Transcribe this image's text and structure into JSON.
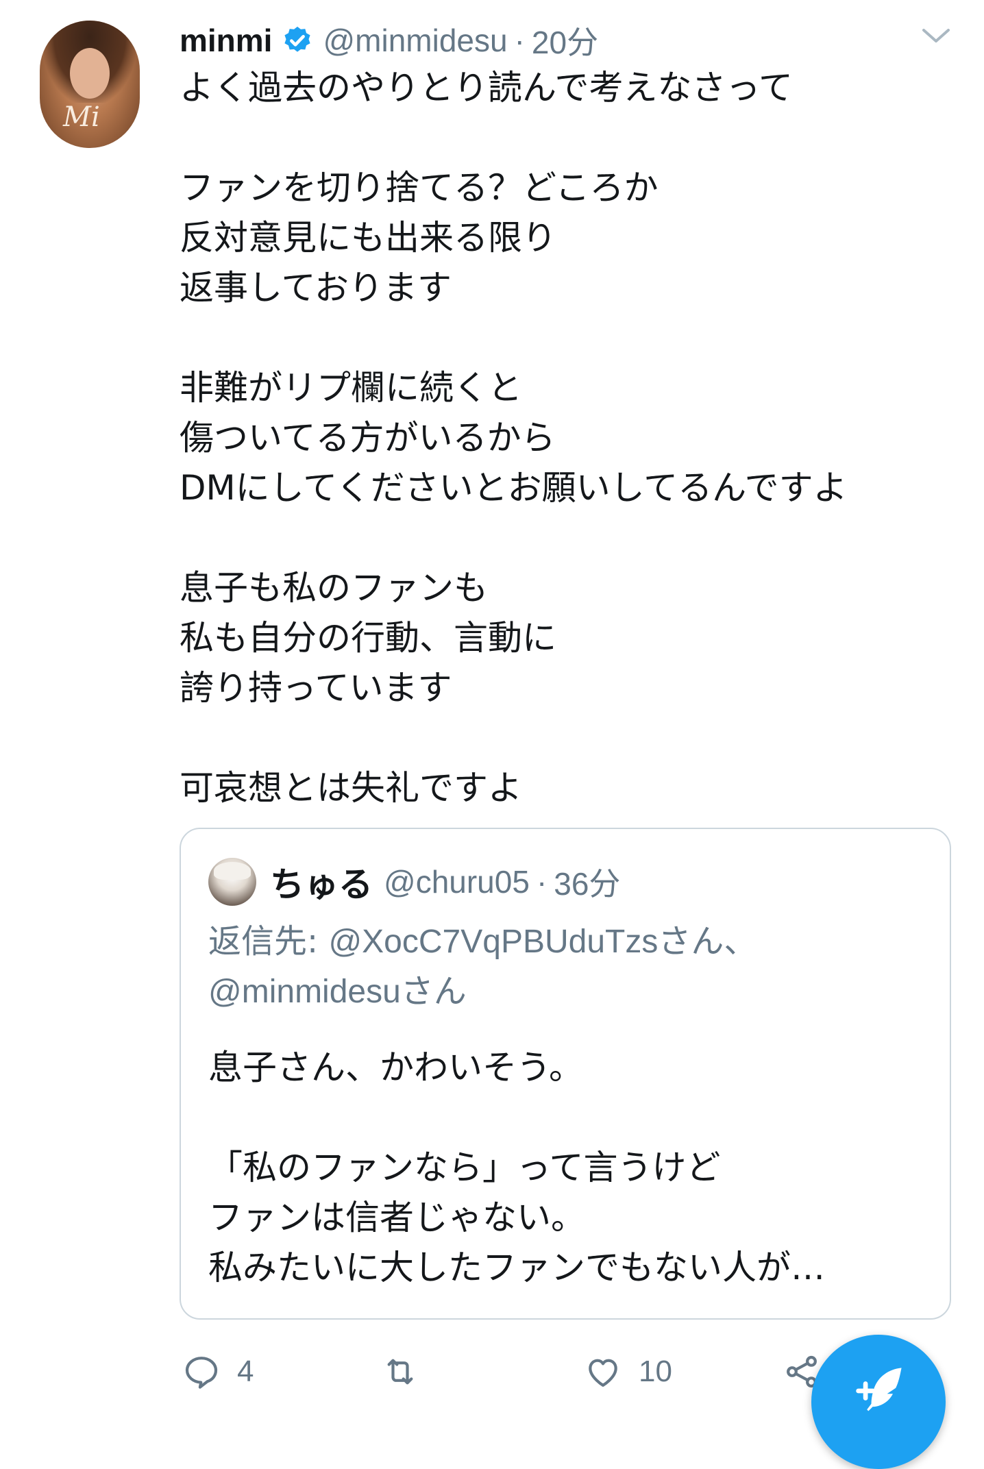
{
  "tweet": {
    "author": {
      "name": "minmi",
      "handle": "@minmidesu",
      "verified": true,
      "avatar_signature": "Mi"
    },
    "separator": "·",
    "time": "20分",
    "text": "よく過去のやりとり読んで考えなさって\n\nファンを切り捨てる？どころか\n反対意見にも出来る限り\n返事しております\n\n非難がリプ欄に続くと\n傷ついてる方がいるから\nDMにしてくださいとお願いしてるんですよ\n\n息子も私のファンも\n私も自分の行動、言動に\n誇り持っています\n\n可哀想とは失礼ですよ",
    "quoted": {
      "name": "ちゅる",
      "handle": "@churu05",
      "separator": "·",
      "time": "36分",
      "reply_label": "返信先: ",
      "reply_mention_1": "@XocC7VqPBUduTzsさん、",
      "reply_mention_2": "@minmidesuさん",
      "text": "息子さん、かわいそう。\n\n「私のファンなら」って言うけど\nファンは信者じゃない。\n私みたいに大したファンでもない人が…"
    },
    "actions": {
      "reply_count": "4",
      "retweet_count": "",
      "like_count": "10"
    }
  },
  "colors": {
    "accent": "#1da1f2",
    "secondary_text": "#657786",
    "border": "#ccd6dd"
  },
  "icons": [
    "verified-badge-icon",
    "chevron-down-icon",
    "reply-icon",
    "retweet-icon",
    "like-icon",
    "share-icon",
    "compose-tweet-icon"
  ]
}
